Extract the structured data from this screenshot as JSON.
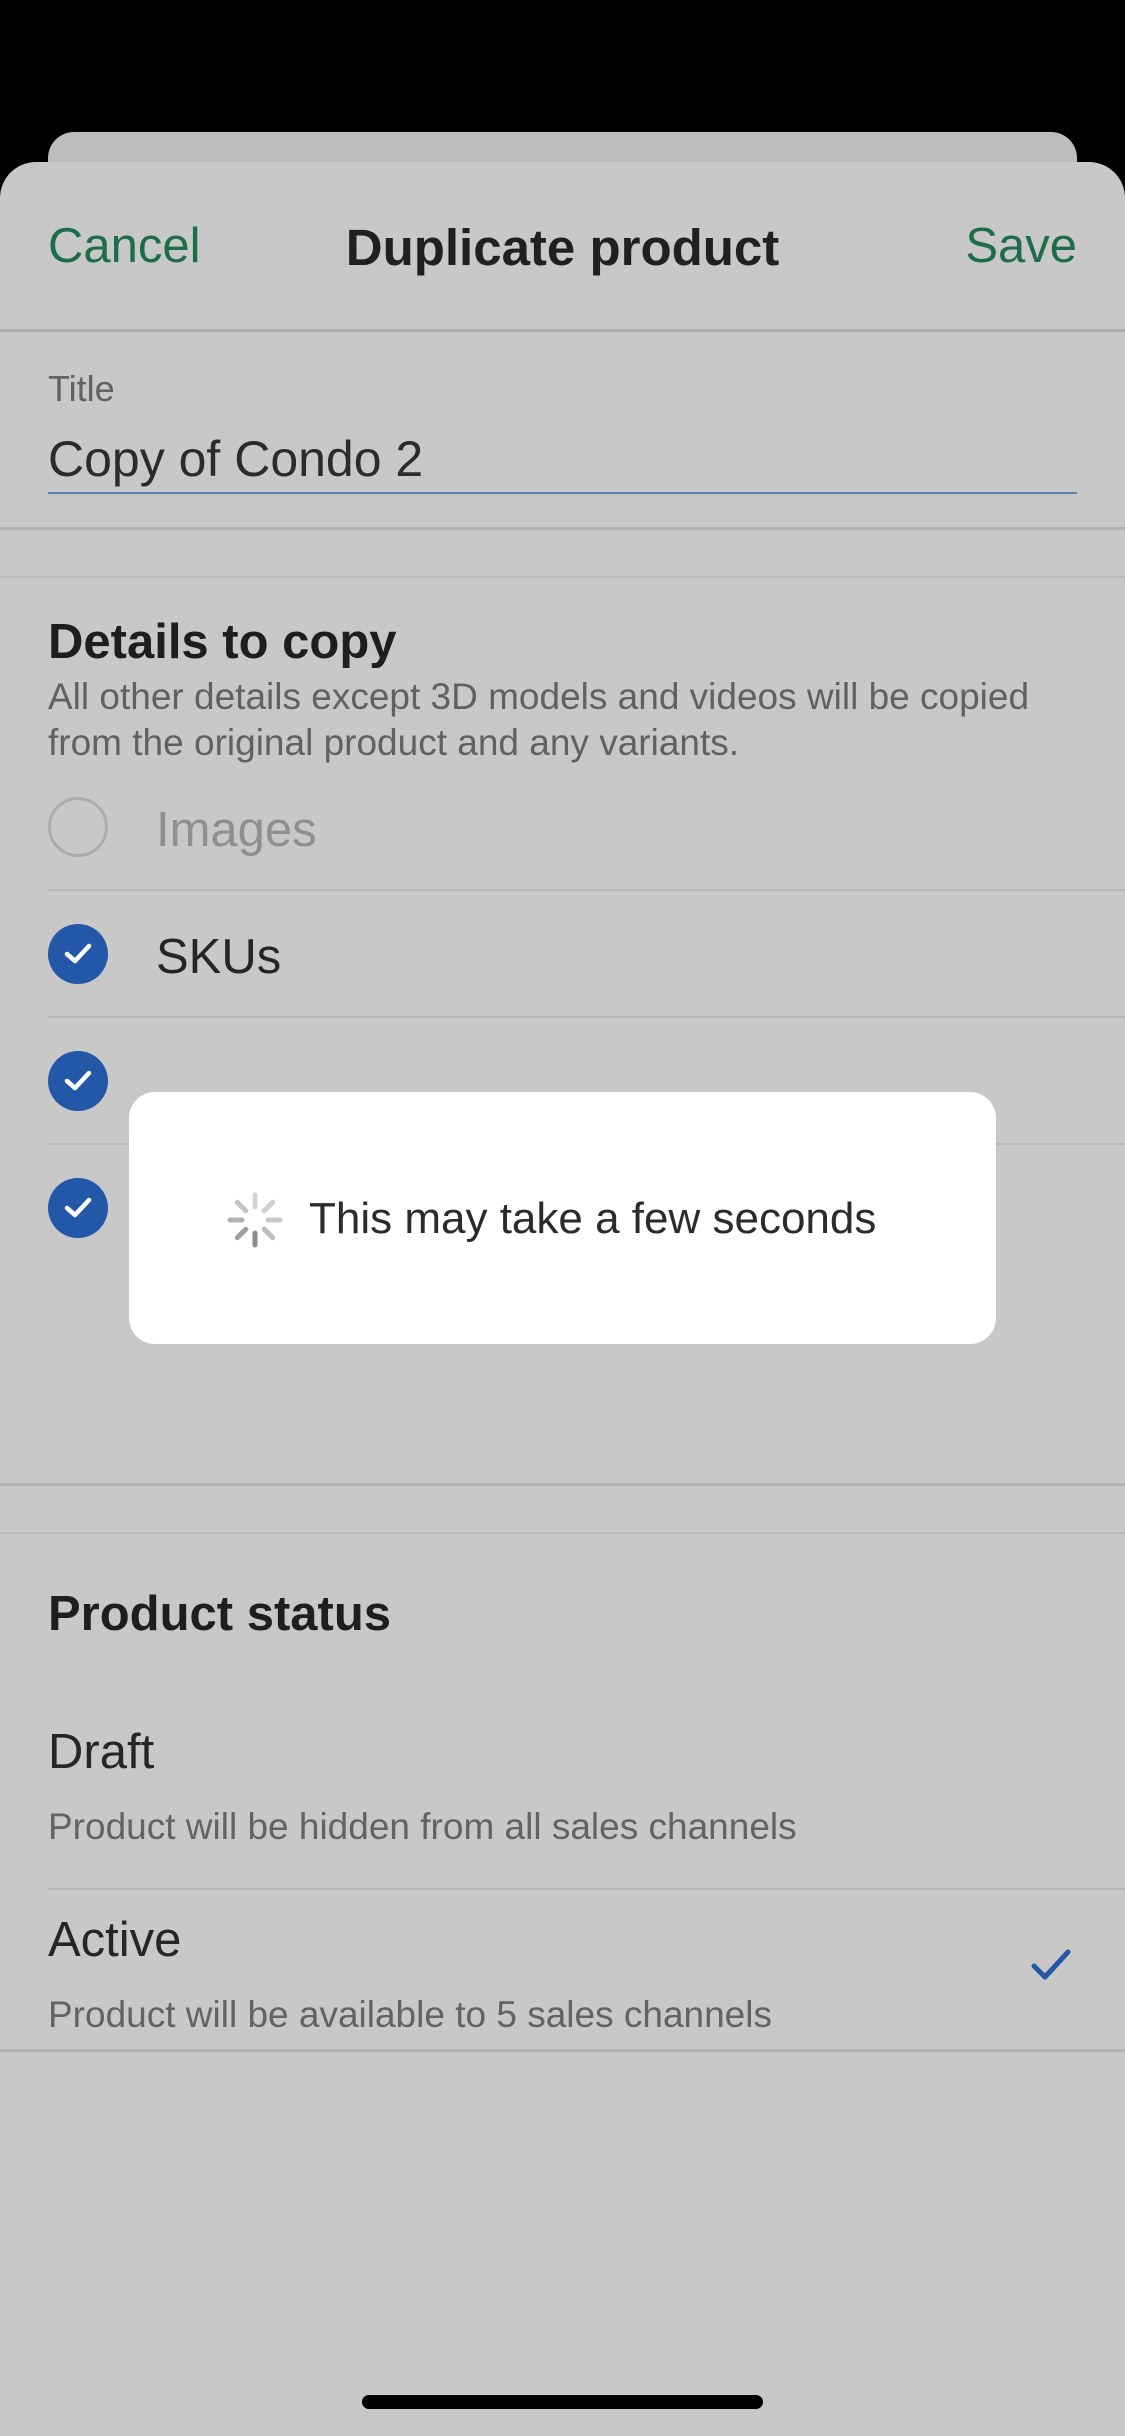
{
  "nav": {
    "cancel_label": "Cancel",
    "title": "Duplicate product",
    "save_label": "Save"
  },
  "title_field": {
    "label": "Title",
    "value": "Copy of Condo 2"
  },
  "details": {
    "heading": "Details to copy",
    "description": "All other details except 3D models and videos will be copied from the original product and any variants.",
    "options": [
      {
        "label": "Images",
        "checked": false,
        "enabled": false
      },
      {
        "label": "SKUs",
        "checked": true,
        "enabled": true
      },
      {
        "label": "",
        "checked": true,
        "enabled": true
      },
      {
        "label": "",
        "checked": true,
        "enabled": true
      }
    ]
  },
  "product_status": {
    "heading": "Product status",
    "options": [
      {
        "title": "Draft",
        "description": "Product will be hidden from all sales channels",
        "selected": false
      },
      {
        "title": "Active",
        "description": "Product will be available to 5 sales channels",
        "selected": true
      }
    ]
  },
  "loading_modal": {
    "message": "This may take a few seconds"
  },
  "colors": {
    "accent_green": "#1d6d4a",
    "checkbox_blue": "#2357a8"
  },
  "icons": [
    "check-icon",
    "spinner-icon",
    "checkmark-icon"
  ]
}
